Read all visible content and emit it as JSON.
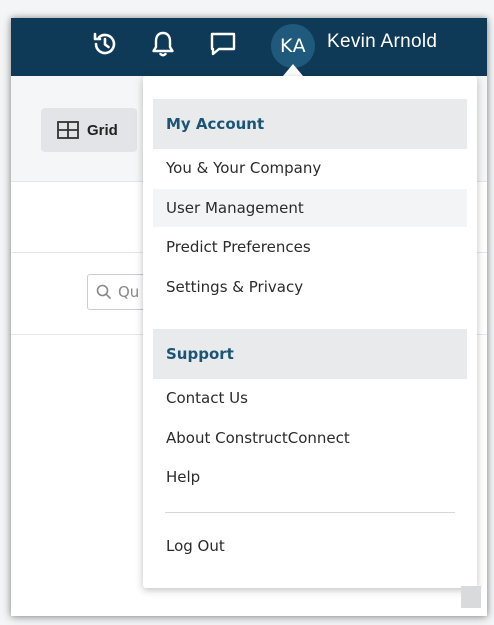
{
  "topbar": {
    "history_icon": "history-icon",
    "bell_icon": "bell-icon",
    "chat_icon": "chat-icon",
    "avatar_initials": "KA",
    "user_name": "Kevin Arnold",
    "color": "#0f3a57"
  },
  "toolbar": {
    "grid_label": "Grid",
    "grid_icon": "grid-icon"
  },
  "search": {
    "placeholder": "Qu",
    "icon": "search-icon"
  },
  "menu": {
    "sections": [
      {
        "header": "My Account",
        "items": [
          "You & Your Company",
          "User Management",
          "Predict Preferences",
          "Settings & Privacy"
        ]
      },
      {
        "header": "Support",
        "items": [
          "Contact Us",
          "About ConstructConnect",
          "Help"
        ]
      }
    ],
    "logout_label": "Log Out",
    "header_color": "#1a5476"
  }
}
